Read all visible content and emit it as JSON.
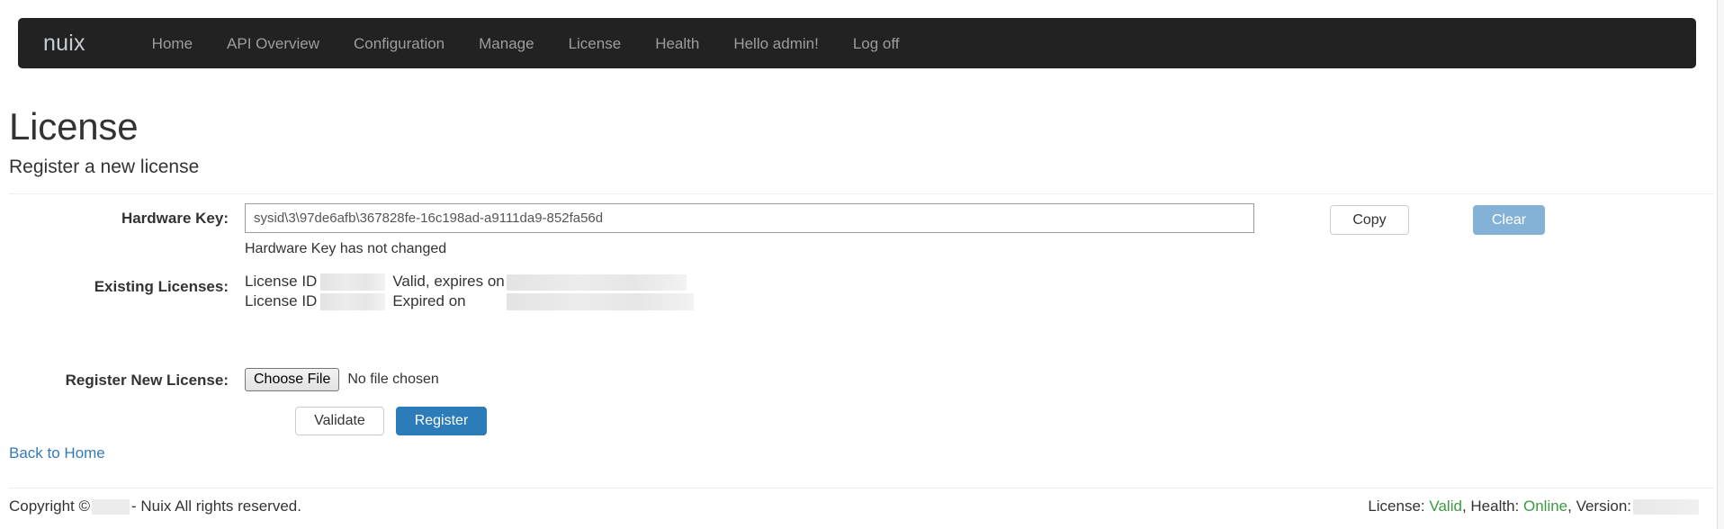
{
  "navbar": {
    "brand": "nuix",
    "links": [
      {
        "label": "Home"
      },
      {
        "label": "API Overview"
      },
      {
        "label": "Configuration"
      },
      {
        "label": "Manage"
      },
      {
        "label": "License"
      },
      {
        "label": "Health"
      },
      {
        "label": "Hello admin!"
      },
      {
        "label": "Log off"
      }
    ]
  },
  "header": {
    "title": "License",
    "subtitle": "Register a new license"
  },
  "form": {
    "hardware_key": {
      "label": "Hardware Key:",
      "value": "sysid\\3\\97de6afb\\367828fe-16c198ad-a9111da9-852fa56d",
      "note": "Hardware Key has not changed",
      "copy_label": "Copy",
      "clear_label": "Clear"
    },
    "existing_licenses": {
      "label": "Existing Licenses:",
      "rows": [
        {
          "id_label": "License ID",
          "id_value": "",
          "status": "Valid, expires on",
          "date_value": ""
        },
        {
          "id_label": "License ID",
          "id_value": "",
          "status": "Expired on",
          "date_value": ""
        }
      ]
    },
    "register_new": {
      "label": "Register New License:",
      "choose_file_label": "Choose File",
      "file_name": "No file chosen"
    },
    "actions": {
      "validate_label": "Validate",
      "register_label": "Register"
    }
  },
  "back_link": {
    "label": "Back to Home"
  },
  "footer": {
    "copyright_prefix": "Copyright ©",
    "copyright_suffix": "- Nuix All rights reserved.",
    "status_license_label": "License:",
    "status_license_value": "Valid",
    "status_health_label": ", Health:",
    "status_health_value": "Online",
    "status_version_label": ", Version:"
  },
  "colors": {
    "navbar_bg": "#222222",
    "primary": "#2b7cb8",
    "primary_muted": "#84b2d6",
    "link": "#337ab7",
    "status_green": "#3c9a40"
  }
}
